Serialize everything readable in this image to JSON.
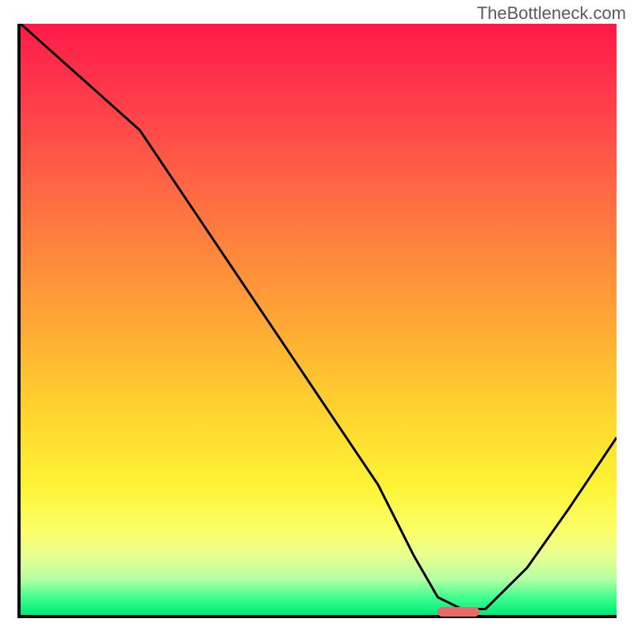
{
  "watermark": "TheBottleneck.com",
  "chart_data": {
    "type": "line",
    "title": "",
    "xlabel": "",
    "ylabel": "",
    "xlim": [
      0,
      100
    ],
    "ylim": [
      0,
      100
    ],
    "grid": false,
    "legend": false,
    "series": [
      {
        "name": "bottleneck-curve",
        "x": [
          0,
          10,
          20,
          30,
          40,
          50,
          60,
          66,
          70,
          74,
          78,
          85,
          92,
          100
        ],
        "y": [
          100,
          91,
          82,
          67,
          52,
          37,
          22,
          10,
          3,
          1,
          1,
          8,
          18,
          30
        ]
      }
    ],
    "marker": {
      "x_start": 70,
      "x_end": 77,
      "y": 0,
      "color": "#e76a6a"
    },
    "background_gradient": {
      "stops": [
        {
          "pos": 0.0,
          "color": "#ff1a48"
        },
        {
          "pos": 0.2,
          "color": "#ff5048"
        },
        {
          "pos": 0.5,
          "color": "#ffa636"
        },
        {
          "pos": 0.78,
          "color": "#fff335"
        },
        {
          "pos": 0.94,
          "color": "#b3ffa3"
        },
        {
          "pos": 1.0,
          "color": "#00e87a"
        }
      ]
    }
  }
}
